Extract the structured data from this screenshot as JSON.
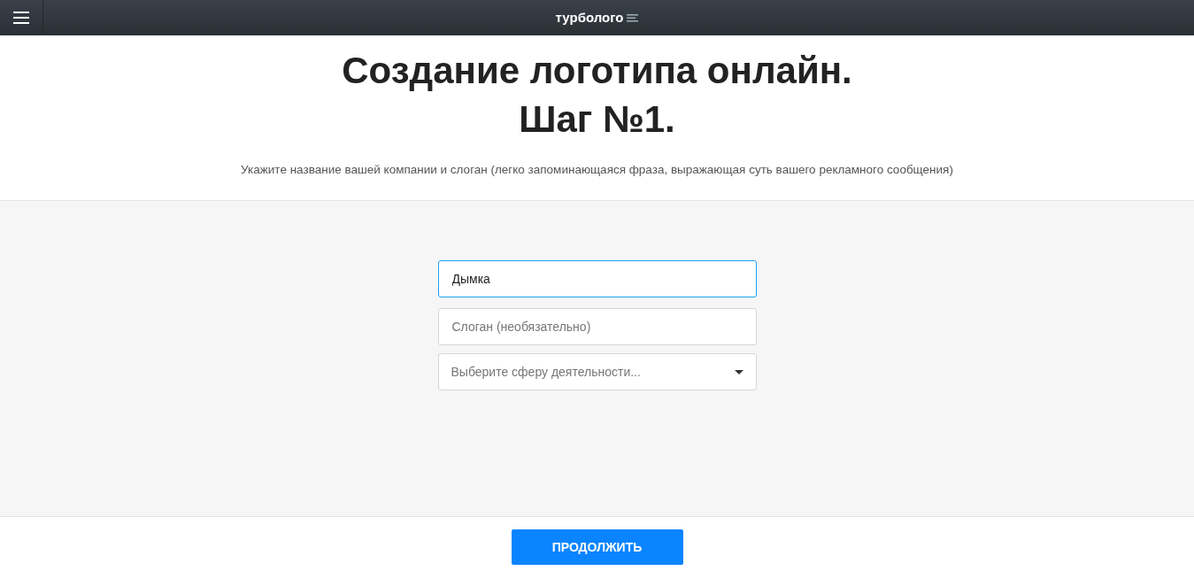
{
  "navbar": {
    "logo": "турболого"
  },
  "heading": {
    "lines": [
      "Создание логотипа онлайн.",
      "Шаг №1."
    ],
    "subtitle": "Укажите название вашей компании и слоган (легко запоминающаяся фраза, выражающая суть вашего рекламного сообщения)"
  },
  "form": {
    "fields": [
      {
        "kind": "input",
        "value": "Дымка",
        "focused": true
      },
      {
        "kind": "input",
        "placeholder": "Слоган (необязательно)",
        "focused": false
      },
      {
        "kind": "select",
        "placeholder": "Выберите сферу деятельности...",
        "focused": false
      }
    ]
  },
  "footer": {
    "button": "ПРОДОЛЖИТЬ"
  }
}
